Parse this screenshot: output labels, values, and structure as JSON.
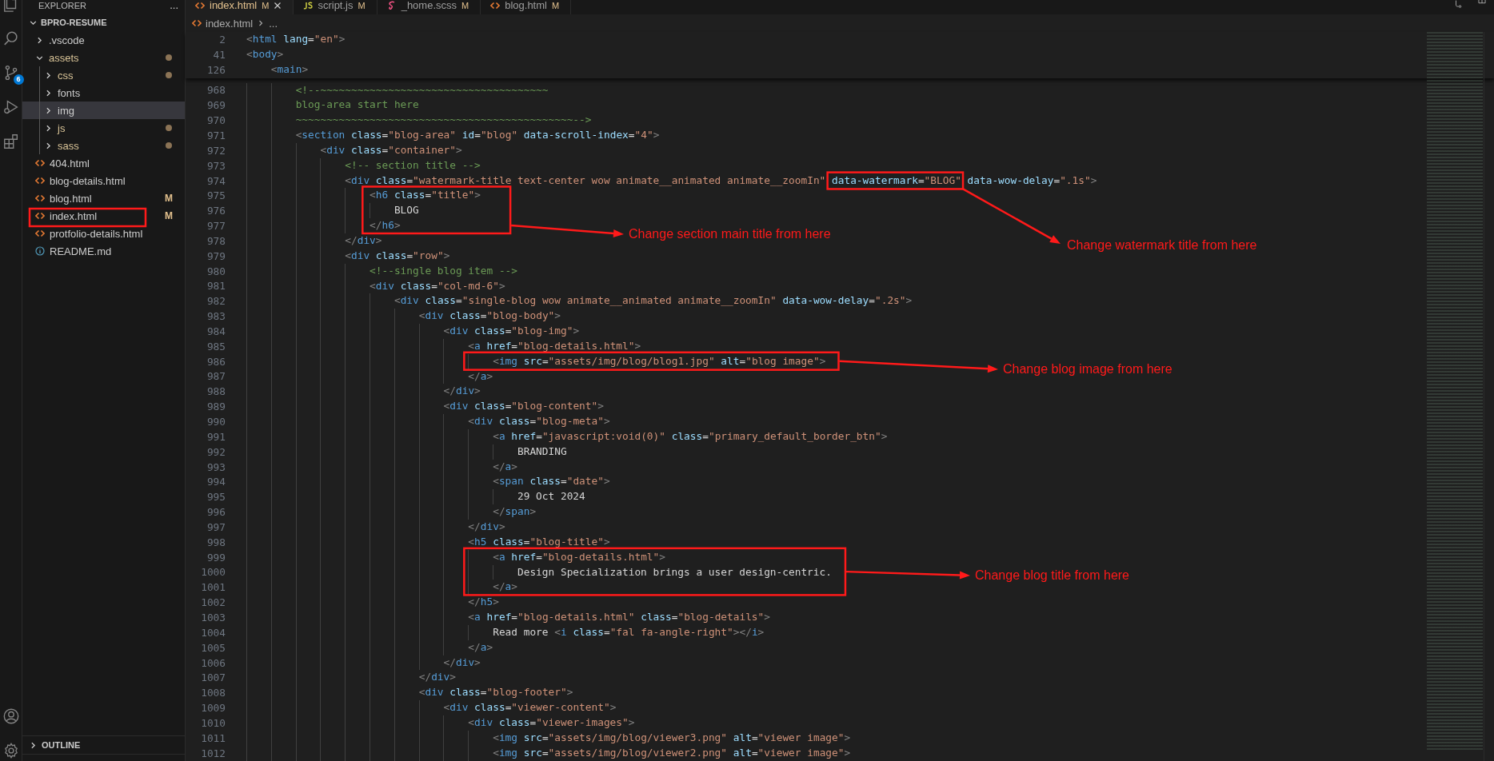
{
  "activity_bar": {
    "source_control_badge": "6"
  },
  "explorer": {
    "title": "EXPLORER",
    "more": "...",
    "project": "BPRO-RESUME",
    "project_expanded": true,
    "items": [
      {
        "name": ".vscode",
        "kind": "folder",
        "expanded": false,
        "changed": false,
        "selected": false
      },
      {
        "name": "assets",
        "kind": "folder",
        "expanded": true,
        "changed": true,
        "selected": false,
        "children": [
          {
            "name": "css",
            "kind": "folder",
            "expanded": false,
            "changed": true,
            "selected": false
          },
          {
            "name": "fonts",
            "kind": "folder",
            "expanded": false,
            "changed": false,
            "selected": false
          },
          {
            "name": "img",
            "kind": "folder",
            "expanded": false,
            "changed": false,
            "selected": true
          },
          {
            "name": "js",
            "kind": "folder",
            "expanded": false,
            "changed": true,
            "selected": false
          },
          {
            "name": "sass",
            "kind": "folder",
            "expanded": false,
            "changed": true,
            "selected": false
          }
        ]
      },
      {
        "name": "404.html",
        "kind": "html",
        "selected": false
      },
      {
        "name": "blog-details.html",
        "kind": "html",
        "selected": false
      },
      {
        "name": "blog.html",
        "kind": "html",
        "badge": "M",
        "selected": false
      },
      {
        "name": "index.html",
        "kind": "html",
        "badge": "M",
        "selected": false
      },
      {
        "name": "protfolio-details.html",
        "kind": "html",
        "selected": false
      },
      {
        "name": "README.md",
        "kind": "info",
        "selected": false
      }
    ]
  },
  "outline": {
    "title": "OUTLINE",
    "expanded": false
  },
  "tabs": [
    {
      "label": "index.html",
      "status": "M",
      "kind": "html",
      "selected": true
    },
    {
      "label": "script.js",
      "status": "M",
      "kind": "js",
      "selected": false
    },
    {
      "label": "_home.scss",
      "status": "M",
      "kind": "scss",
      "selected": false
    },
    {
      "label": "blog.html",
      "status": "M",
      "kind": "html",
      "selected": false
    }
  ],
  "breadcrumb": {
    "file": "index.html",
    "more": "..."
  },
  "sticky_lines": [
    {
      "number": "2",
      "text": "<html lang=\"en\">"
    },
    {
      "number": "41",
      "text": "<body>"
    },
    {
      "number": "126",
      "text": "    <main>"
    }
  ],
  "lines": [
    {
      "number": "968",
      "text": "        <!--~~~~~~~~~~~~~~~~~~~~~~~~~~~~~~~~~~~~~"
    },
    {
      "number": "969",
      "text": "        blog-area start here"
    },
    {
      "number": "970",
      "text": "        ~~~~~~~~~~~~~~~~~~~~~~~~~~~~~~~~~~~~~~~~~~~~~-->"
    },
    {
      "number": "971",
      "text": "        <section class=\"blog-area\" id=\"blog\" data-scroll-index=\"4\">"
    },
    {
      "number": "972",
      "text": "            <div class=\"container\">"
    },
    {
      "number": "973",
      "text": "                <!-- section title -->"
    },
    {
      "number": "974",
      "text": "                <div class=\"watermark-title text-center wow animate__animated animate__zoomIn\" data-watermark=\"BLOG\" data-wow-delay=\".1s\">"
    },
    {
      "number": "975",
      "text": "                    <h6 class=\"title\">"
    },
    {
      "number": "976",
      "text": "                        BLOG"
    },
    {
      "number": "977",
      "text": "                    </h6>"
    },
    {
      "number": "978",
      "text": "                </div>"
    },
    {
      "number": "979",
      "text": "                <div class=\"row\">"
    },
    {
      "number": "980",
      "text": "                    <!--single blog item -->"
    },
    {
      "number": "981",
      "text": "                    <div class=\"col-md-6\">"
    },
    {
      "number": "982",
      "text": "                        <div class=\"single-blog wow animate__animated animate__zoomIn\" data-wow-delay=\".2s\">"
    },
    {
      "number": "983",
      "text": "                            <div class=\"blog-body\">"
    },
    {
      "number": "984",
      "text": "                                <div class=\"blog-img\">"
    },
    {
      "number": "985",
      "text": "                                    <a href=\"blog-details.html\">"
    },
    {
      "number": "986",
      "text": "                                        <img src=\"assets/img/blog/blog1.jpg\" alt=\"blog image\">"
    },
    {
      "number": "987",
      "text": "                                    </a>"
    },
    {
      "number": "988",
      "text": "                                </div>"
    },
    {
      "number": "989",
      "text": "                                <div class=\"blog-content\">"
    },
    {
      "number": "990",
      "text": "                                    <div class=\"blog-meta\">"
    },
    {
      "number": "991",
      "text": "                                        <a href=\"javascript:void(0)\" class=\"primary_default_border_btn\">"
    },
    {
      "number": "992",
      "text": "                                            BRANDING"
    },
    {
      "number": "993",
      "text": "                                        </a>"
    },
    {
      "number": "994",
      "text": "                                        <span class=\"date\">"
    },
    {
      "number": "995",
      "text": "                                            29 Oct 2024"
    },
    {
      "number": "996",
      "text": "                                        </span>"
    },
    {
      "number": "997",
      "text": "                                    </div>"
    },
    {
      "number": "998",
      "text": "                                    <h5 class=\"blog-title\">"
    },
    {
      "number": "999",
      "text": "                                        <a href=\"blog-details.html\">"
    },
    {
      "number": "1000",
      "text": "                                            Design Specialization brings a user design-centric."
    },
    {
      "number": "1001",
      "text": "                                        </a>"
    },
    {
      "number": "1002",
      "text": "                                    </h5>"
    },
    {
      "number": "1003",
      "text": "                                    <a href=\"blog-details.html\" class=\"blog-details\">"
    },
    {
      "number": "1004",
      "text": "                                        Read more <i class=\"fal fa-angle-right\"></i>"
    },
    {
      "number": "1005",
      "text": "                                    </a>"
    },
    {
      "number": "1006",
      "text": "                                </div>"
    },
    {
      "number": "1007",
      "text": "                            </div>"
    },
    {
      "number": "1008",
      "text": "                            <div class=\"blog-footer\">"
    },
    {
      "number": "1009",
      "text": "                                <div class=\"viewer-content\">"
    },
    {
      "number": "1010",
      "text": "                                    <div class=\"viewer-images\">"
    },
    {
      "number": "1011",
      "text": "                                        <img src=\"assets/img/blog/viewer3.png\" alt=\"viewer image\">"
    },
    {
      "number": "1012",
      "text": "                                        <img src=\"assets/img/blog/viewer2.png\" alt=\"viewer image\">"
    }
  ],
  "annotations": [
    {
      "text": "Change section main title from here"
    },
    {
      "text": "Change watermark title from here"
    },
    {
      "text": "Change blog image from here"
    },
    {
      "text": "Change blog title from here"
    }
  ]
}
